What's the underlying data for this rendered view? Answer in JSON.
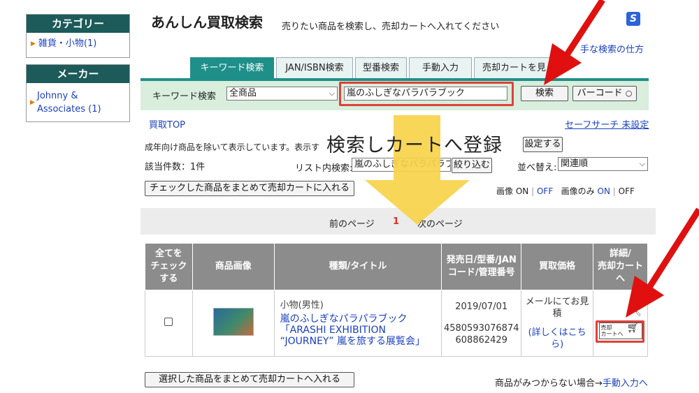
{
  "sidebar": {
    "category_title": "カテゴリー",
    "category_item": "雑貨・小物(1)",
    "maker_title": "メーカー",
    "maker_item_line1": "Johnny &",
    "maker_item_line2": "Associates (1)"
  },
  "header": {
    "title": "あんしん買取検索",
    "subtitle": "売りたい商品を検索し、売却カートへ入れてください",
    "how_to_link": "手な検索の仕方"
  },
  "tabs": [
    {
      "label": "キーワード検索"
    },
    {
      "label": "JAN/ISBN検索"
    },
    {
      "label": "型番検索"
    },
    {
      "label": "手動入力"
    },
    {
      "label": "売却カートを見"
    }
  ],
  "search": {
    "label": "キーワード検索",
    "category_value": "全商品",
    "keyword_value": "嵐のふしぎなパラパラブック",
    "search_button": "検索",
    "barcode_button": "バーコード"
  },
  "nav": {
    "top_link": "買取TOP",
    "safe_search": "セーフサーチ 未設定"
  },
  "notice": {
    "adult_text": "成年向け商品を除いて表示しています。表示す",
    "setting_button": "設定する"
  },
  "results": {
    "count_text": "該当件数：1件",
    "in_list_label": "リスト内検索:",
    "in_list_value": "嵐のふしぎなパラパラブ",
    "narrow_button": "絞り込む",
    "sort_label": "並べ替え:",
    "sort_value": "関連順",
    "bulk_add_button": "チェックした商品をまとめて売却カートに入れる",
    "image_label": "画像",
    "image_only_label": "画像のみ",
    "on": "ON",
    "off": "OFF",
    "separator": "|"
  },
  "pager": {
    "prev": "前のページ",
    "current": "1",
    "next": "次のページ"
  },
  "table": {
    "headers": {
      "check_all_1": "全てを",
      "check_all_2": "チェック",
      "check_all_3": "する",
      "image": "商品画像",
      "title": "種類/タイトル",
      "date_1": "発売日/型番/JAN",
      "date_2": "コード/管理番号",
      "price": "買取価格",
      "detail_1": "詳細/",
      "detail_2": "売却カート",
      "detail_3": "へ"
    },
    "row": {
      "type": "小物(男性)",
      "title_1": "嵐のふしぎなパラパラブック",
      "title_2": "「ARASHI EXHIBITION",
      "title_3": "“JOURNEY” 嵐を旅する展覧会」",
      "date": "2019/07/01",
      "code_1": "4580593076874",
      "code_2": "608862429",
      "price_1": "メールにてお見",
      "price_2": "積",
      "price_link_1": "(詳しくはこち",
      "price_link_2": "ら)",
      "cart_btn_1": "売却",
      "cart_btn_2": "カートへ"
    }
  },
  "footer": {
    "bulk_selected_button": "選択した商品をまとめて売却カートへ入れる",
    "not_found_text": "商品がみつからない場合→",
    "manual_link": "手動入力へ"
  },
  "overlay": {
    "caption": "検索しカートへ登録"
  },
  "colors": {
    "teal": "#1f8f8a",
    "arrow_red": "#e01010",
    "highlight_red": "#e0413a",
    "arrow_yellow": "#f7d24a"
  }
}
